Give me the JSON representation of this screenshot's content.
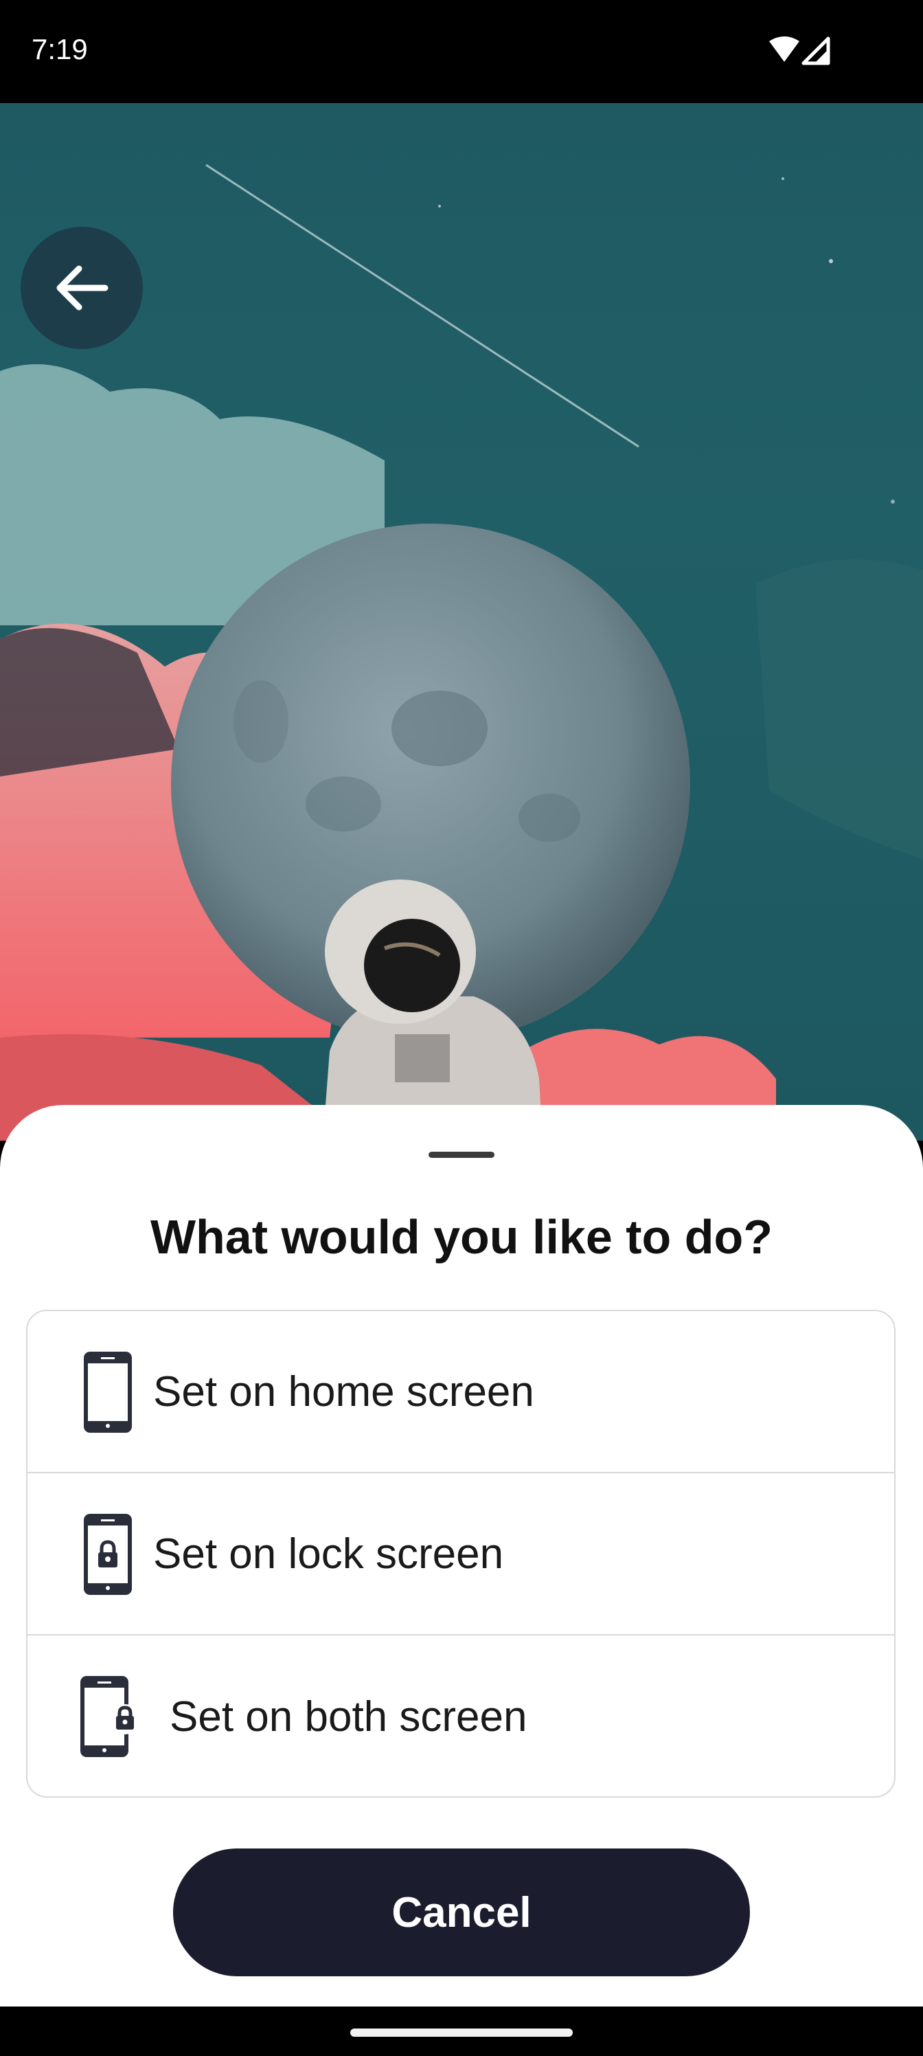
{
  "status_bar": {
    "time": "7:19",
    "icons": [
      "wifi-icon",
      "cell-signal-icon"
    ]
  },
  "preview": {
    "back_icon": "arrow-left-icon"
  },
  "sheet": {
    "title": "What would you like to do?",
    "options": [
      {
        "label": "Set on home screen",
        "icon": "phone-icon"
      },
      {
        "label": "Set on lock screen",
        "icon": "phone-lock-icon"
      },
      {
        "label": "Set on both screen",
        "icon": "phone-both-icon"
      }
    ],
    "cancel_label": "Cancel"
  },
  "colors": {
    "sheet_bg": "#ffffff",
    "button_bg": "#1b1d2e",
    "sky": "#1f5a63",
    "clouds_pink": "#f07375"
  }
}
